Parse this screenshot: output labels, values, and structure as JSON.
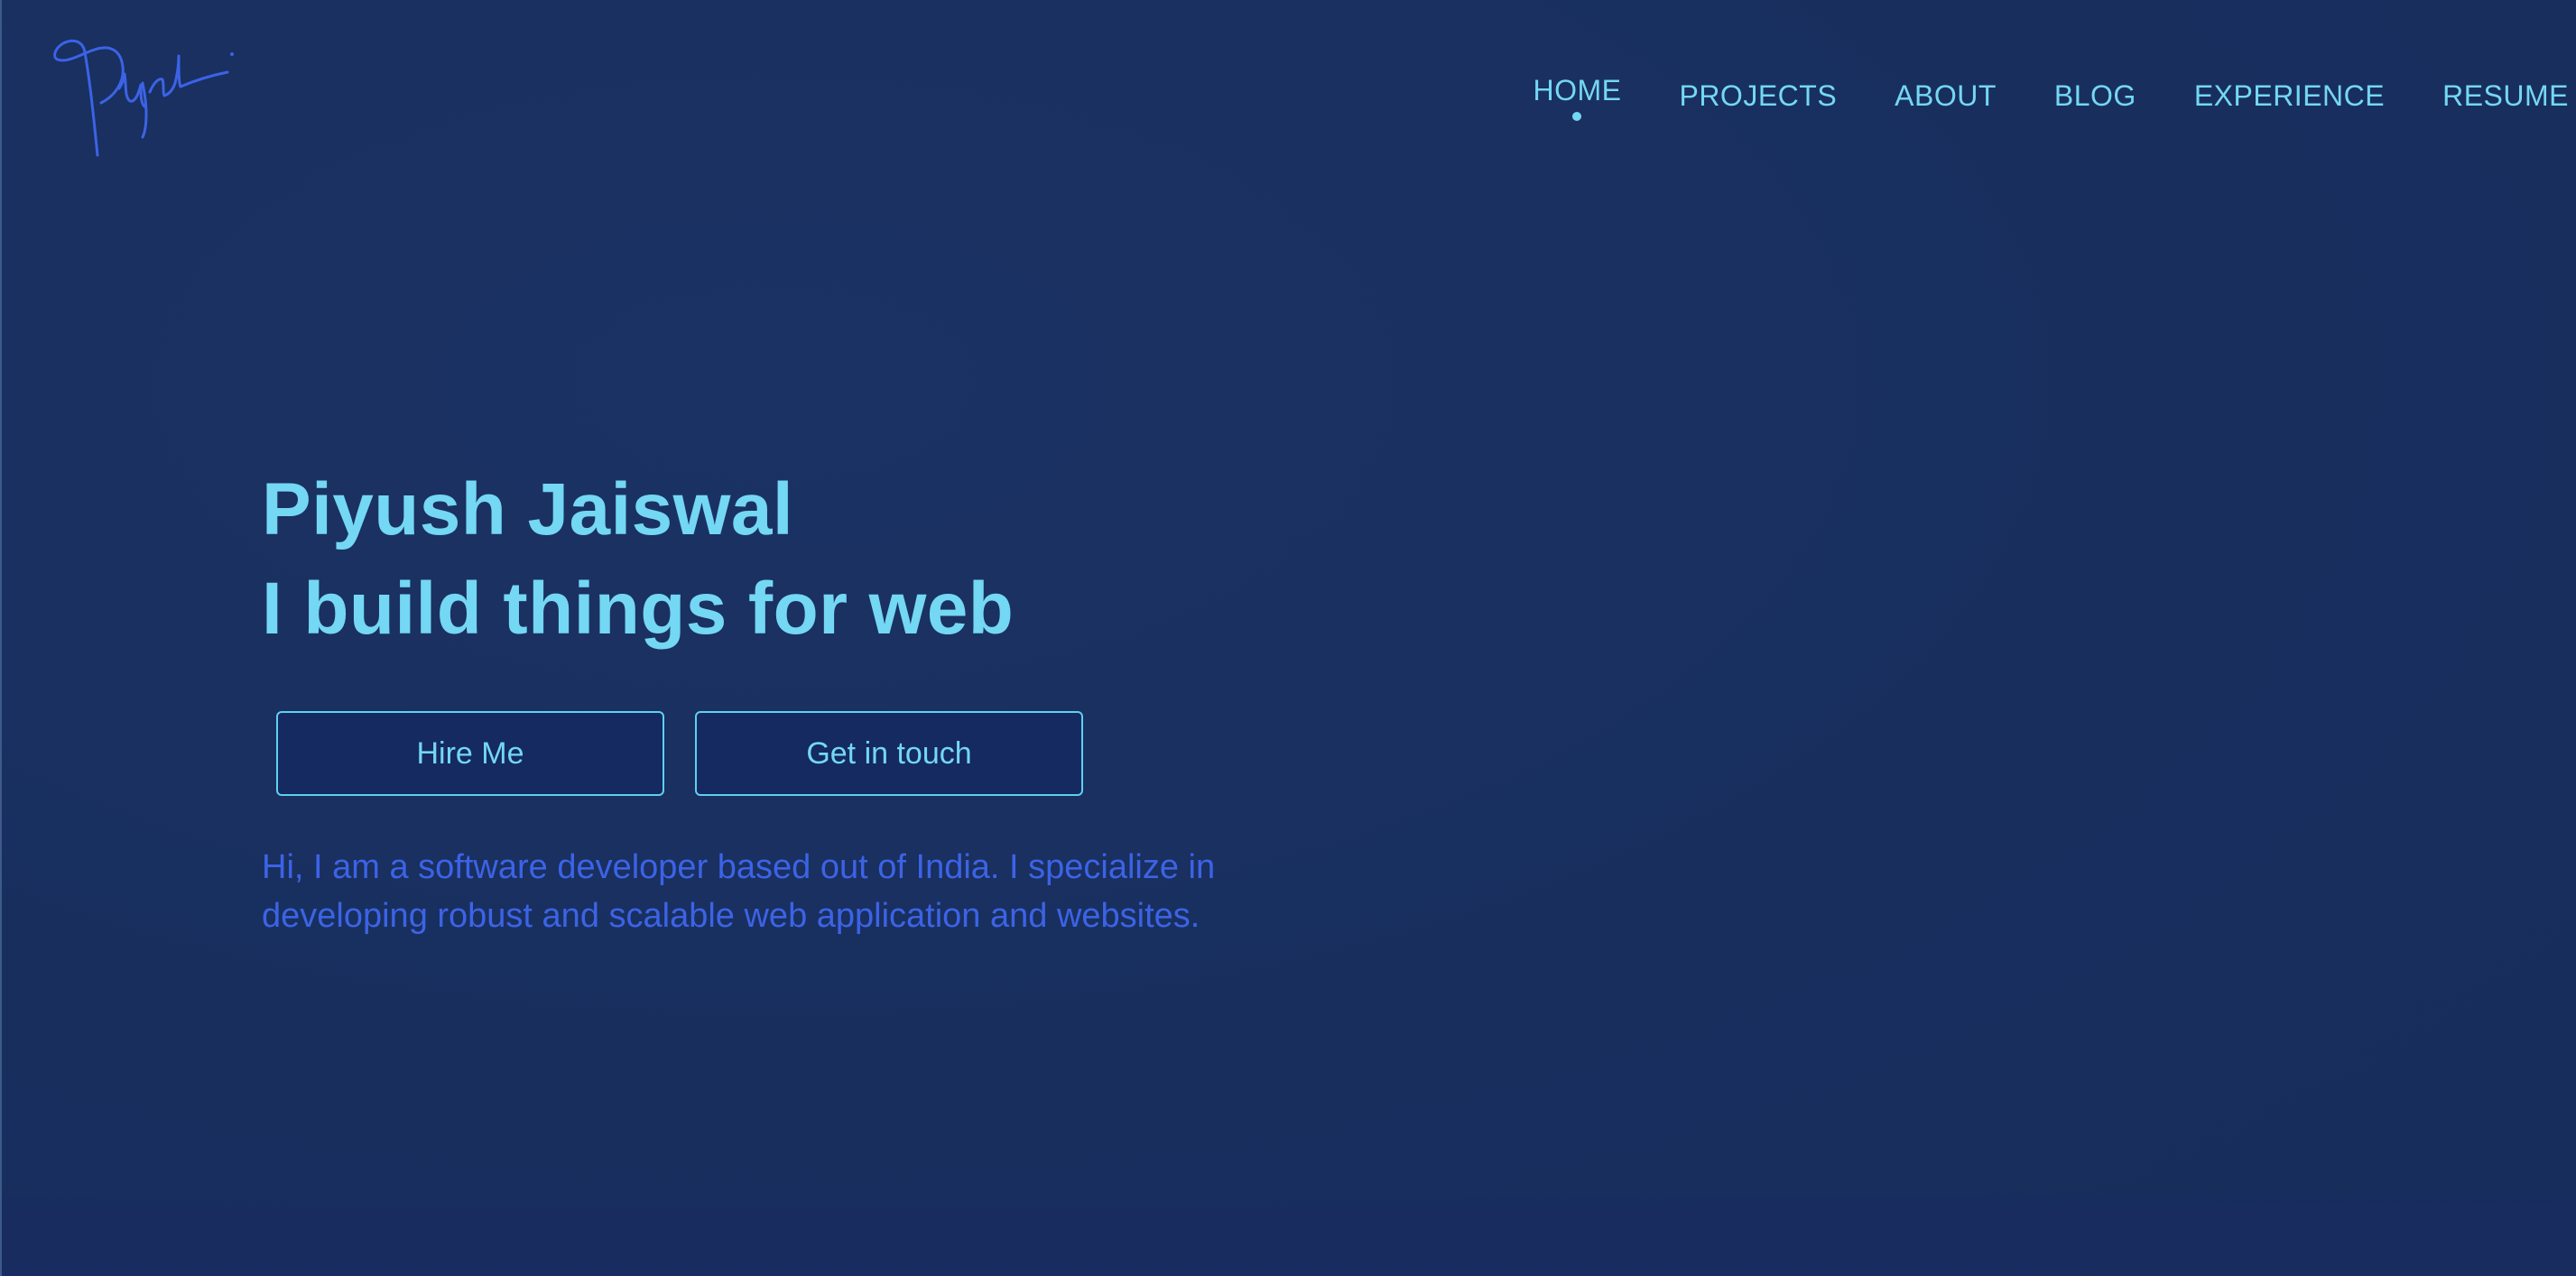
{
  "brand": {
    "signature_text": "Piyush",
    "logo_icon": "signature-logo",
    "logo_color": "#3c63e6"
  },
  "nav": {
    "items": [
      {
        "label": "HOME",
        "active": true
      },
      {
        "label": "PROJECTS",
        "active": false
      },
      {
        "label": "ABOUT",
        "active": false
      },
      {
        "label": "BLOG",
        "active": false
      },
      {
        "label": "EXPERIENCE",
        "active": false
      },
      {
        "label": "RESUME",
        "active": false
      }
    ]
  },
  "hero": {
    "title_line1": "Piyush Jaiswal",
    "title_line2": "I build things for web",
    "buttons": {
      "hire": "Hire Me",
      "contact": "Get in touch"
    },
    "description": "Hi, I am a software developer based out of India. I specialize in developing robust and scalable web application and websites."
  },
  "colors": {
    "background": "#1a3062",
    "accent": "#74d7f3",
    "description_text": "#3c63e6",
    "button_bg": "#142a60"
  }
}
